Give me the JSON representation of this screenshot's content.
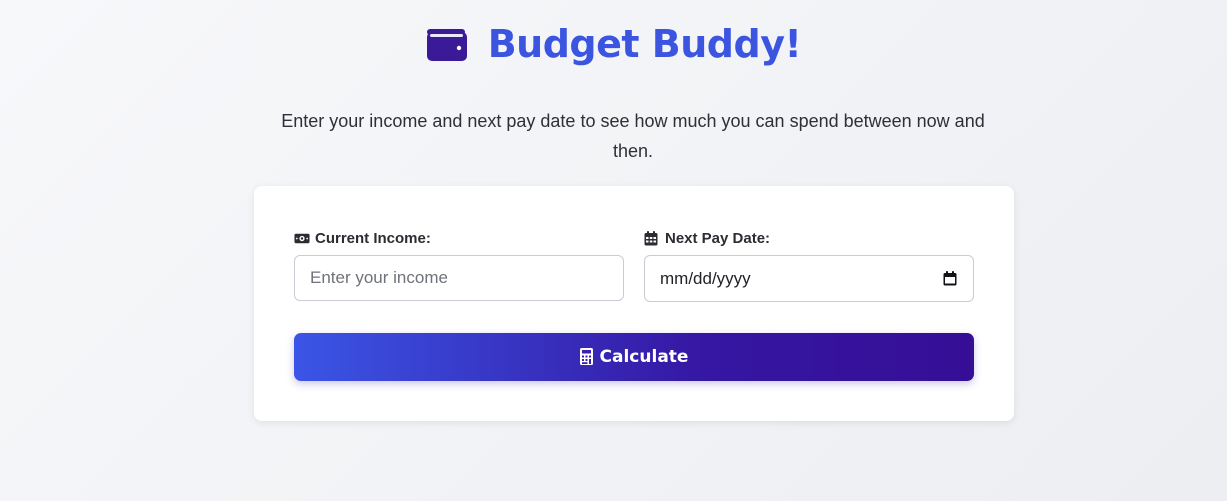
{
  "header": {
    "title": "Budget Buddy!",
    "icon": "wallet-icon"
  },
  "intro": {
    "text": "Enter your income and next pay date to see how much you can spend between now and then."
  },
  "form": {
    "income": {
      "label": "Current Income:",
      "icon": "money-bill-icon",
      "placeholder": "Enter your income",
      "value": ""
    },
    "pay_date": {
      "label": "Next Pay Date:",
      "icon": "calendar-icon",
      "value": "mm/dd/yyyy"
    },
    "calculate": {
      "label": "Calculate",
      "icon": "calculator-icon"
    }
  },
  "colors": {
    "accent": "#3b55e0",
    "wallet": "#3a1a96",
    "button_start": "#3b55e6",
    "button_end": "#360e96"
  }
}
